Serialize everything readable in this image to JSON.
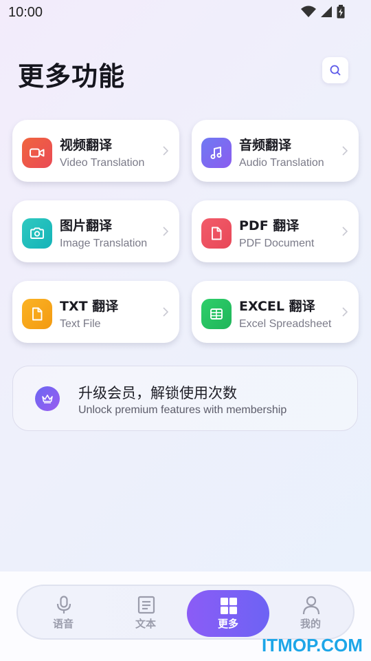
{
  "status_bar": {
    "time": "10:00"
  },
  "header": {
    "title": "更多功能"
  },
  "cards": [
    {
      "title": "视频翻译",
      "subtitle": "Video Translation",
      "icon": "video-camera-icon",
      "color_from": "#f0653e",
      "color_to": "#ea4a55"
    },
    {
      "title": "音频翻译",
      "subtitle": "Audio Translation",
      "icon": "music-note-icon",
      "color_from": "#6f7af2",
      "color_to": "#8a5cf0"
    },
    {
      "title": "图片翻译",
      "subtitle": "Image Translation",
      "icon": "camera-icon",
      "color_from": "#2fc9c0",
      "color_to": "#14b3b8"
    },
    {
      "title": "PDF 翻译",
      "subtitle": "PDF Document",
      "icon": "document-icon",
      "color_from": "#f25c6a",
      "color_to": "#e84858"
    },
    {
      "title": "TXT 翻译",
      "subtitle": "Text File",
      "icon": "file-icon",
      "color_from": "#fbb324",
      "color_to": "#f39a12"
    },
    {
      "title": "EXCEL 翻译",
      "subtitle": "Excel Spreadsheet",
      "icon": "table-icon",
      "color_from": "#2fcf6a",
      "color_to": "#1fb55a"
    }
  ],
  "membership": {
    "title": "升级会员，解锁使用次数",
    "subtitle": "Unlock premium features with membership",
    "icon": "crown-icon"
  },
  "nav": [
    {
      "label": "语音",
      "icon": "microphone-icon"
    },
    {
      "label": "文本",
      "icon": "text-document-icon"
    },
    {
      "label": "更多",
      "icon": "grid-icon",
      "active": true
    },
    {
      "label": "我的",
      "icon": "person-icon"
    }
  ],
  "watermark": "ITMOP.COM",
  "colors": {
    "accent": "#7c5ff5",
    "text_secondary": "#7a7a88"
  }
}
